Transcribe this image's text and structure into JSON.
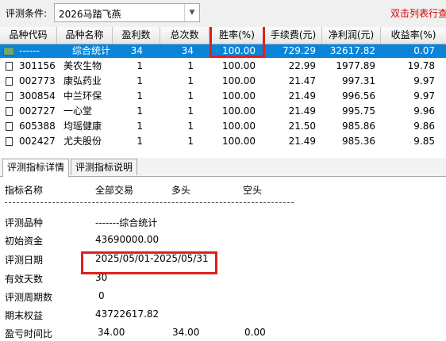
{
  "toolbar": {
    "condition_label": "评测条件:",
    "condition_value": "2026马踏飞燕",
    "hint": "双击列表行查"
  },
  "table": {
    "columns": [
      "品种代码",
      "品种名称",
      "盈利数",
      "总次数",
      "胜率(%)",
      "手续费(元)",
      "净利润(元)",
      "收益率(%)"
    ],
    "rows": [
      {
        "code": "------",
        "name": "综合统计",
        "profit": "34",
        "total": "34",
        "win": "100.00",
        "fee": "729.29",
        "net": "32617.82",
        "ret": "0.07"
      },
      {
        "code": "301156",
        "name": "美农生物",
        "profit": "1",
        "total": "1",
        "win": "100.00",
        "fee": "22.99",
        "net": "1977.89",
        "ret": "19.78"
      },
      {
        "code": "002773",
        "name": "康弘药业",
        "profit": "1",
        "total": "1",
        "win": "100.00",
        "fee": "21.47",
        "net": "997.31",
        "ret": "9.97"
      },
      {
        "code": "300854",
        "name": "中兰环保",
        "profit": "1",
        "total": "1",
        "win": "100.00",
        "fee": "21.49",
        "net": "996.56",
        "ret": "9.97"
      },
      {
        "code": "002727",
        "name": "一心堂",
        "profit": "1",
        "total": "1",
        "win": "100.00",
        "fee": "21.49",
        "net": "995.75",
        "ret": "9.96"
      },
      {
        "code": "605388",
        "name": "均瑶健康",
        "profit": "1",
        "total": "1",
        "win": "100.00",
        "fee": "21.50",
        "net": "985.86",
        "ret": "9.86"
      },
      {
        "code": "002427",
        "name": "尤夫股份",
        "profit": "1",
        "total": "1",
        "win": "100.00",
        "fee": "21.49",
        "net": "985.36",
        "ret": "9.85"
      }
    ]
  },
  "tabs": [
    "评测指标详情",
    "评测指标说明"
  ],
  "detail": {
    "headers": [
      "指标名称",
      "全部交易",
      "多头",
      "空头"
    ],
    "divider": "--------------------------------------------------------------------------------------------",
    "items": [
      {
        "label": "评测品种",
        "all": "-------综合统计",
        "long": "",
        "short": ""
      },
      {
        "label": "初始资金",
        "all": "43690000.00",
        "long": "",
        "short": ""
      },
      {
        "label": "评测日期",
        "all": "2025/05/01-2025/05/31",
        "long": "",
        "short": ""
      },
      {
        "label": "有效天数",
        "all": "30",
        "long": "",
        "short": ""
      },
      {
        "label": "评测周期数",
        "all": "0",
        "long": "",
        "short": ""
      },
      {
        "label": "期末权益",
        "all": "43722617.82",
        "long": "",
        "short": ""
      },
      {
        "label": "盈亏时间比",
        "all": "34.00",
        "long": "34.00",
        "short": "0.00"
      }
    ]
  },
  "colors": {
    "selection": "#0a84d8",
    "highlight": "#e0201c",
    "hint": "#d40000"
  },
  "icons": [
    "dropdown-arrow-icon",
    "summary-table-icon",
    "document-icon"
  ]
}
